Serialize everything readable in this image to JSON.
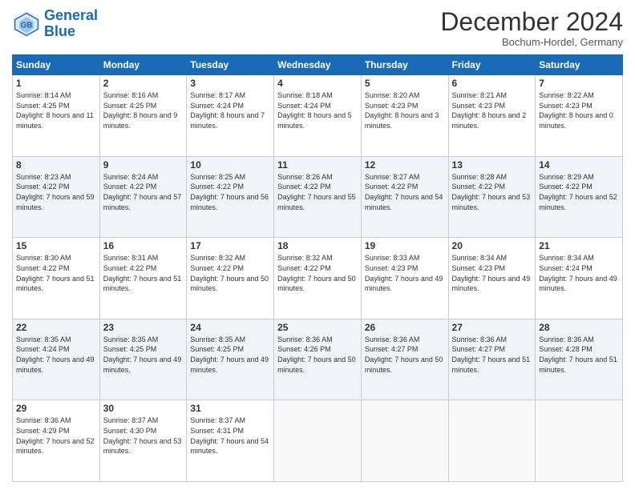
{
  "header": {
    "logo_line1": "General",
    "logo_line2": "Blue",
    "month": "December 2024",
    "location": "Bochum-Hordel, Germany"
  },
  "weekdays": [
    "Sunday",
    "Monday",
    "Tuesday",
    "Wednesday",
    "Thursday",
    "Friday",
    "Saturday"
  ],
  "weeks": [
    [
      {
        "day": "1",
        "sunrise": "Sunrise: 8:14 AM",
        "sunset": "Sunset: 4:25 PM",
        "daylight": "Daylight: 8 hours and 11 minutes."
      },
      {
        "day": "2",
        "sunrise": "Sunrise: 8:16 AM",
        "sunset": "Sunset: 4:25 PM",
        "daylight": "Daylight: 8 hours and 9 minutes."
      },
      {
        "day": "3",
        "sunrise": "Sunrise: 8:17 AM",
        "sunset": "Sunset: 4:24 PM",
        "daylight": "Daylight: 8 hours and 7 minutes."
      },
      {
        "day": "4",
        "sunrise": "Sunrise: 8:18 AM",
        "sunset": "Sunset: 4:24 PM",
        "daylight": "Daylight: 8 hours and 5 minutes."
      },
      {
        "day": "5",
        "sunrise": "Sunrise: 8:20 AM",
        "sunset": "Sunset: 4:23 PM",
        "daylight": "Daylight: 8 hours and 3 minutes."
      },
      {
        "day": "6",
        "sunrise": "Sunrise: 8:21 AM",
        "sunset": "Sunset: 4:23 PM",
        "daylight": "Daylight: 8 hours and 2 minutes."
      },
      {
        "day": "7",
        "sunrise": "Sunrise: 8:22 AM",
        "sunset": "Sunset: 4:23 PM",
        "daylight": "Daylight: 8 hours and 0 minutes."
      }
    ],
    [
      {
        "day": "8",
        "sunrise": "Sunrise: 8:23 AM",
        "sunset": "Sunset: 4:22 PM",
        "daylight": "Daylight: 7 hours and 59 minutes."
      },
      {
        "day": "9",
        "sunrise": "Sunrise: 8:24 AM",
        "sunset": "Sunset: 4:22 PM",
        "daylight": "Daylight: 7 hours and 57 minutes."
      },
      {
        "day": "10",
        "sunrise": "Sunrise: 8:25 AM",
        "sunset": "Sunset: 4:22 PM",
        "daylight": "Daylight: 7 hours and 56 minutes."
      },
      {
        "day": "11",
        "sunrise": "Sunrise: 8:26 AM",
        "sunset": "Sunset: 4:22 PM",
        "daylight": "Daylight: 7 hours and 55 minutes."
      },
      {
        "day": "12",
        "sunrise": "Sunrise: 8:27 AM",
        "sunset": "Sunset: 4:22 PM",
        "daylight": "Daylight: 7 hours and 54 minutes."
      },
      {
        "day": "13",
        "sunrise": "Sunrise: 8:28 AM",
        "sunset": "Sunset: 4:22 PM",
        "daylight": "Daylight: 7 hours and 53 minutes."
      },
      {
        "day": "14",
        "sunrise": "Sunrise: 8:29 AM",
        "sunset": "Sunset: 4:22 PM",
        "daylight": "Daylight: 7 hours and 52 minutes."
      }
    ],
    [
      {
        "day": "15",
        "sunrise": "Sunrise: 8:30 AM",
        "sunset": "Sunset: 4:22 PM",
        "daylight": "Daylight: 7 hours and 51 minutes."
      },
      {
        "day": "16",
        "sunrise": "Sunrise: 8:31 AM",
        "sunset": "Sunset: 4:22 PM",
        "daylight": "Daylight: 7 hours and 51 minutes."
      },
      {
        "day": "17",
        "sunrise": "Sunrise: 8:32 AM",
        "sunset": "Sunset: 4:22 PM",
        "daylight": "Daylight: 7 hours and 50 minutes."
      },
      {
        "day": "18",
        "sunrise": "Sunrise: 8:32 AM",
        "sunset": "Sunset: 4:22 PM",
        "daylight": "Daylight: 7 hours and 50 minutes."
      },
      {
        "day": "19",
        "sunrise": "Sunrise: 8:33 AM",
        "sunset": "Sunset: 4:23 PM",
        "daylight": "Daylight: 7 hours and 49 minutes."
      },
      {
        "day": "20",
        "sunrise": "Sunrise: 8:34 AM",
        "sunset": "Sunset: 4:23 PM",
        "daylight": "Daylight: 7 hours and 49 minutes."
      },
      {
        "day": "21",
        "sunrise": "Sunrise: 8:34 AM",
        "sunset": "Sunset: 4:24 PM",
        "daylight": "Daylight: 7 hours and 49 minutes."
      }
    ],
    [
      {
        "day": "22",
        "sunrise": "Sunrise: 8:35 AM",
        "sunset": "Sunset: 4:24 PM",
        "daylight": "Daylight: 7 hours and 49 minutes."
      },
      {
        "day": "23",
        "sunrise": "Sunrise: 8:35 AM",
        "sunset": "Sunset: 4:25 PM",
        "daylight": "Daylight: 7 hours and 49 minutes."
      },
      {
        "day": "24",
        "sunrise": "Sunrise: 8:35 AM",
        "sunset": "Sunset: 4:25 PM",
        "daylight": "Daylight: 7 hours and 49 minutes."
      },
      {
        "day": "25",
        "sunrise": "Sunrise: 8:36 AM",
        "sunset": "Sunset: 4:26 PM",
        "daylight": "Daylight: 7 hours and 50 minutes."
      },
      {
        "day": "26",
        "sunrise": "Sunrise: 8:36 AM",
        "sunset": "Sunset: 4:27 PM",
        "daylight": "Daylight: 7 hours and 50 minutes."
      },
      {
        "day": "27",
        "sunrise": "Sunrise: 8:36 AM",
        "sunset": "Sunset: 4:27 PM",
        "daylight": "Daylight: 7 hours and 51 minutes."
      },
      {
        "day": "28",
        "sunrise": "Sunrise: 8:36 AM",
        "sunset": "Sunset: 4:28 PM",
        "daylight": "Daylight: 7 hours and 51 minutes."
      }
    ],
    [
      {
        "day": "29",
        "sunrise": "Sunrise: 8:36 AM",
        "sunset": "Sunset: 4:29 PM",
        "daylight": "Daylight: 7 hours and 52 minutes."
      },
      {
        "day": "30",
        "sunrise": "Sunrise: 8:37 AM",
        "sunset": "Sunset: 4:30 PM",
        "daylight": "Daylight: 7 hours and 53 minutes."
      },
      {
        "day": "31",
        "sunrise": "Sunrise: 8:37 AM",
        "sunset": "Sunset: 4:31 PM",
        "daylight": "Daylight: 7 hours and 54 minutes."
      },
      null,
      null,
      null,
      null
    ]
  ]
}
